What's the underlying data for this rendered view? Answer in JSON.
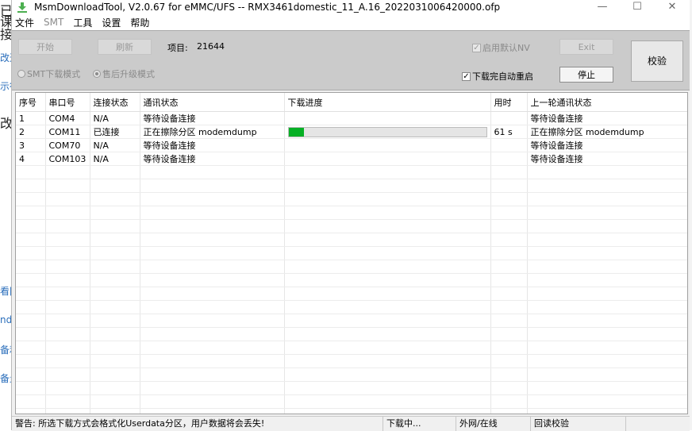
{
  "background": {
    "fragments": [
      {
        "text": "已",
        "style": "dark"
      },
      {
        "text": "课件",
        "style": "dark"
      },
      {
        "text": "接,",
        "style": "dark"
      },
      {
        "text": "改造",
        "style": "link"
      },
      {
        "text": "示行",
        "style": "link"
      },
      {
        "text": "改",
        "style": "dark"
      },
      {
        "text": "看网",
        "style": "link"
      },
      {
        "text": "nde",
        "style": "link"
      },
      {
        "text": "备利",
        "style": "link"
      },
      {
        "text": "备量",
        "style": "link"
      }
    ]
  },
  "window": {
    "title": "MsmDownloadTool, V2.0.67 for eMMC/UFS -- RMX3461domestic_11_A.16_2022031006420000.ofp",
    "controls": {
      "minimize": "—",
      "maximize": "☐",
      "close": "✕"
    }
  },
  "menu": [
    "文件",
    "SMT",
    "工具",
    "设置",
    "帮助"
  ],
  "toolbar": {
    "start_label": "开始",
    "refresh_label": "刷新",
    "project_label": "项目:",
    "project_value": "21644",
    "default_nv_label": "启用默认NV",
    "exit_label": "Exit",
    "auto_reboot_label": "下载完自动重启",
    "stop_label": "停止",
    "verify_label": "校验",
    "mode_smt_label": "SMT下载模式",
    "mode_aftersale_label": "售后升级模式"
  },
  "table": {
    "columns": [
      "序号",
      "串口号",
      "连接状态",
      "通讯状态",
      "下载进度",
      "用时",
      "上一轮通讯状态"
    ],
    "rows": [
      {
        "index": "1",
        "port": "COM4",
        "conn": "N/A",
        "comm": "等待设备连接",
        "progress": null,
        "time": "",
        "last": "等待设备连接"
      },
      {
        "index": "2",
        "port": "COM11",
        "conn": "已连接",
        "comm": "正在擦除分区 modemdump",
        "progress": 0.08,
        "time": "61 s",
        "last": "正在擦除分区 modemdump"
      },
      {
        "index": "3",
        "port": "COM70",
        "conn": "N/A",
        "comm": "等待设备连接",
        "progress": null,
        "time": "",
        "last": "等待设备连接"
      },
      {
        "index": "4",
        "port": "COM103",
        "conn": "N/A",
        "comm": "等待设备连接",
        "progress": null,
        "time": "",
        "last": "等待设备连接"
      }
    ]
  },
  "status": {
    "warning": "警告: 所选下载方式会格式化Userdata分区，用户数据将会丢失!",
    "downloading": "下载中...",
    "network": "外网/在线",
    "readback": "回读校验"
  },
  "colors": {
    "progress": "#06b025",
    "toolbar": "#cbcbcb"
  }
}
